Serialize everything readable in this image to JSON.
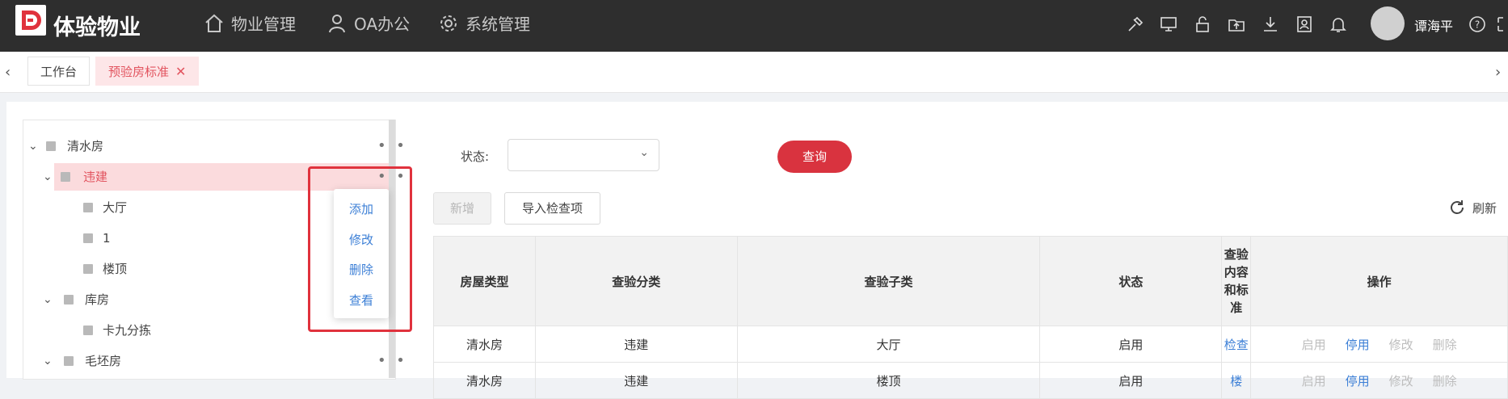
{
  "app": {
    "title": "体验物业"
  },
  "topnav": [
    {
      "label": "物业管理",
      "icon": "home-icon"
    },
    {
      "label": "OA办公",
      "icon": "user-icon"
    },
    {
      "label": "系统管理",
      "icon": "gear-icon"
    }
  ],
  "toolbar_icons": [
    "tools-icon",
    "monitor-icon",
    "lock-icon",
    "upload-icon",
    "download-icon",
    "contact-icon",
    "bell-icon"
  ],
  "user": {
    "name": "谭海平"
  },
  "tabs": [
    {
      "label": "工作台"
    },
    {
      "label": "预验房标准"
    }
  ],
  "tree": [
    {
      "label": "清水房"
    },
    {
      "label": "违建"
    },
    {
      "label": "大厅"
    },
    {
      "label": "1"
    },
    {
      "label": "楼顶"
    },
    {
      "label": "库房"
    },
    {
      "label": "卡九分拣"
    },
    {
      "label": "毛坯房"
    }
  ],
  "context_menu": [
    {
      "label": "添加"
    },
    {
      "label": "修改"
    },
    {
      "label": "删除"
    },
    {
      "label": "查看"
    }
  ],
  "filter": {
    "status_label": "状态:",
    "status_value": "",
    "query_label": "查询"
  },
  "actions": {
    "add_label": "新增",
    "import_label": "导入检查项",
    "refresh_label": "刷新"
  },
  "table": {
    "columns": [
      "房屋类型",
      "查验分类",
      "查验子类",
      "状态",
      "查验内容和标准",
      "操作"
    ],
    "rows": [
      {
        "house_type": "清水房",
        "category": "违建",
        "subcategory": "大厅",
        "status": "启用",
        "content": "检查",
        "ops": [
          "启用",
          "停用",
          "修改",
          "删除"
        ]
      },
      {
        "house_type": "清水房",
        "category": "违建",
        "subcategory": "楼顶",
        "status": "启用",
        "content": "楼",
        "ops": [
          "启用",
          "停用",
          "修改",
          "删除"
        ]
      }
    ]
  },
  "colors": {
    "brand_red": "#d9333f",
    "link_blue": "#3c7fd6",
    "topbar": "#2e2e2e"
  }
}
